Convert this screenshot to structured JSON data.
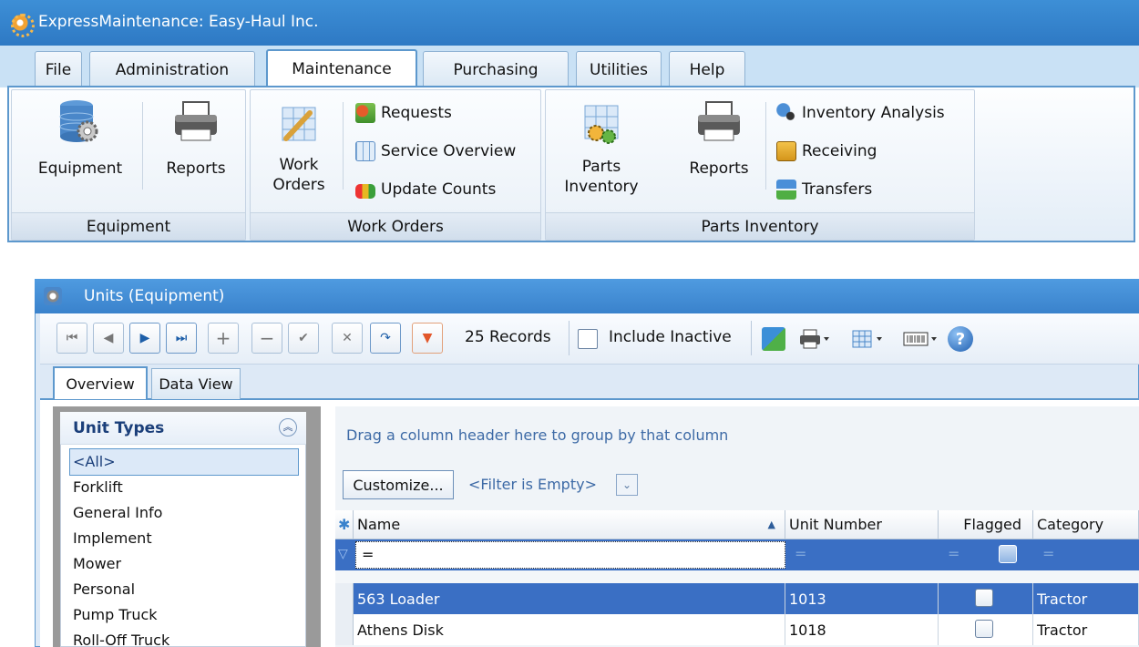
{
  "app": {
    "title": "ExpressMaintenance: Easy-Haul Inc."
  },
  "tabs": [
    "File",
    "Administration",
    "Maintenance",
    "Purchasing",
    "Utilities",
    "Help"
  ],
  "active_tab": "Maintenance",
  "ribbon": {
    "equipment_group": {
      "label": "Equipment",
      "equipment_btn": "Equipment",
      "reports_btn": "Reports"
    },
    "work_orders_group": {
      "label": "Work Orders",
      "work_orders_btn_1": "Work",
      "work_orders_btn_2": "Orders",
      "requests": "Requests",
      "service_overview": "Service Overview",
      "update_counts": "Update Counts"
    },
    "parts_group": {
      "label": "Parts Inventory",
      "parts_btn_1": "Parts",
      "parts_btn_2": "Inventory",
      "reports_btn": "Reports",
      "inventory_analysis": "Inventory Analysis",
      "receiving": "Receiving",
      "transfers": "Transfers"
    }
  },
  "units_window": {
    "title": "Units (Equipment)",
    "records": "25 Records",
    "include_inactive": "Include Inactive",
    "subtabs": [
      "Overview",
      "Data View"
    ],
    "unit_types_title": "Unit Types",
    "unit_types": [
      "<All>",
      "Forklift",
      "General Info",
      "Implement",
      "Mower",
      "Personal",
      "Pump Truck",
      "Roll-Off Truck"
    ],
    "group_hint": "Drag a column header here to group by that column",
    "customize": "Customize...",
    "filter_empty": "<Filter is Empty>",
    "columns": [
      "Name",
      "Unit Number",
      "Flagged",
      "Category"
    ],
    "filter_eq": "=",
    "rows": [
      {
        "name": "563 Loader",
        "unit_number": "1013",
        "category": "Tractor"
      },
      {
        "name": "Athens Disk",
        "unit_number": "1018",
        "category": "Tractor"
      }
    ]
  }
}
